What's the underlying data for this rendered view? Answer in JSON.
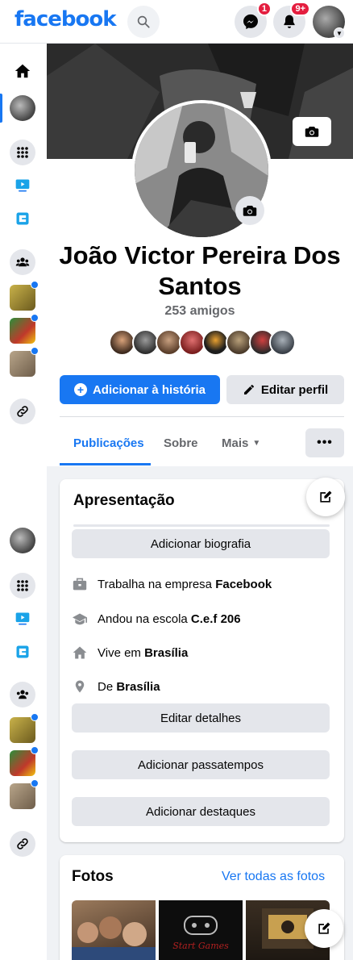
{
  "topbar": {
    "logo": "facebook",
    "messenger_badge": "1",
    "notifications_badge": "9+"
  },
  "colors": {
    "brand": "#1877f2",
    "badge": "#e41e3f",
    "grey_button": "#e4e6eb",
    "background": "#f0f2f5"
  },
  "profile": {
    "name": "João Victor Pereira Dos Santos",
    "friends_count": "253 amigos",
    "add_story_label": "Adicionar à história",
    "edit_profile_label": "Editar perfil"
  },
  "tabs": [
    {
      "label": "Publicações",
      "active": true
    },
    {
      "label": "Sobre",
      "active": false
    },
    {
      "label": "Mais",
      "active": false
    }
  ],
  "more_button": "•••",
  "intro": {
    "title": "Apresentação",
    "add_bio": "Adicionar biografia",
    "rows": [
      {
        "icon": "briefcase-icon",
        "prefix": "Trabalha na empresa ",
        "value": "Facebook"
      },
      {
        "icon": "graduation-cap-icon",
        "prefix": "Andou na escola ",
        "value": "C.e.f 206"
      },
      {
        "icon": "home-icon",
        "prefix": "Vive em ",
        "value": "Brasília"
      },
      {
        "icon": "location-pin-icon",
        "prefix": "De ",
        "value": "Brasília"
      }
    ],
    "edit_details": "Editar detalhes",
    "add_hobbies": "Adicionar passatempos",
    "add_featured": "Adicionar destaques"
  },
  "photos": {
    "title": "Fotos",
    "see_all": "Ver todas as fotos",
    "thumb2_text": "Start Games"
  }
}
